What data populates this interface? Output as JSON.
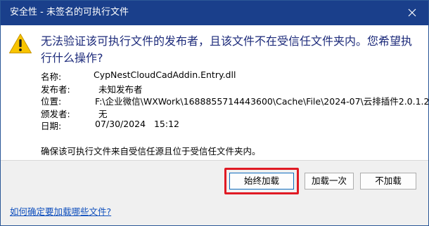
{
  "window": {
    "title": "安全性 - 未签名的可执行文件"
  },
  "message": {
    "question": "无法验证该可执行文件的发布者，且该文件不在受信任文件夹内。您希望执行什么操作?",
    "details": [
      {
        "label": "名称:",
        "value": "CypNestCloudCadAddin.Entry.dll"
      },
      {
        "label": "发布者:",
        "value": "未知发布者"
      },
      {
        "label": "位置:",
        "value": "F:\\企业微信\\WXWork\\1688855714443600\\Cache\\File\\2024-07\\云排插件2.0.1.2"
      },
      {
        "label": "颁发者:",
        "value": "无"
      },
      {
        "label": "日期:",
        "value": "07/30/2024   15:12"
      }
    ],
    "note": "确保该可执行文件来自受信任源且位于受信任文件夹内。"
  },
  "buttons": {
    "always_load": "始终加载",
    "load_once": "加载一次",
    "dont_load": "不加载"
  },
  "help_link": "如何确定要加载哪些文件?",
  "icons": {
    "warning": "warning-icon",
    "close": "close-icon"
  },
  "colors": {
    "titlebar": "#1a3f8b",
    "question_text": "#1c2a7a",
    "highlight": "#e01a24",
    "link": "#0f4fbd"
  }
}
